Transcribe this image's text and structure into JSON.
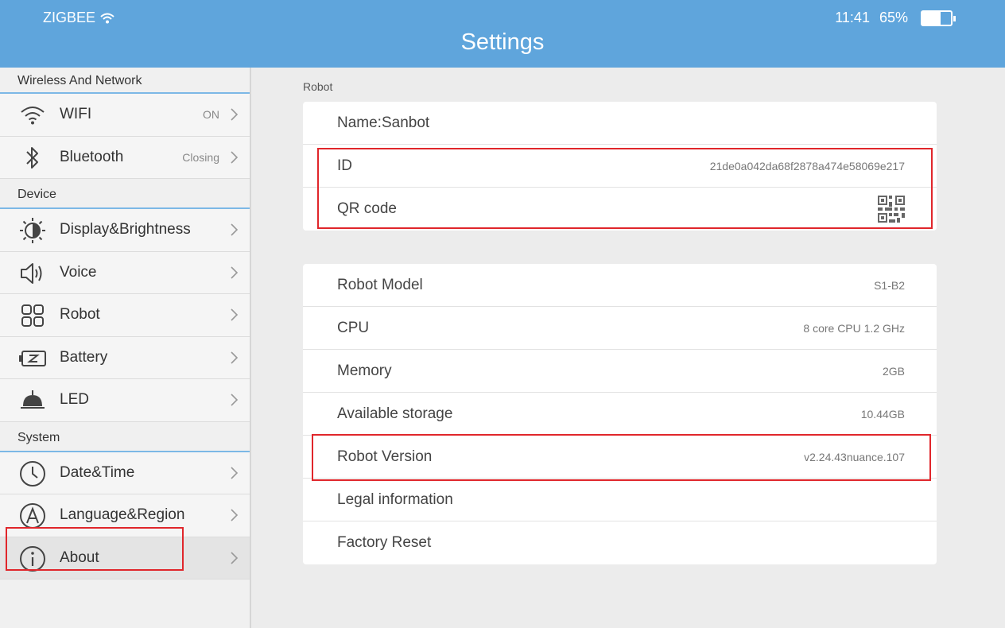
{
  "status_bar": {
    "network": "ZIGBEE",
    "time": "11:41",
    "battery_percent_text": "65%",
    "battery_level": 0.65
  },
  "header": {
    "title": "Settings"
  },
  "sidebar": {
    "sections": [
      {
        "label": "Wireless And Network"
      },
      {
        "label": "Device"
      },
      {
        "label": "System"
      }
    ],
    "items": [
      {
        "label": "WIFI",
        "value": "ON",
        "icon": "wifi-icon"
      },
      {
        "label": "Bluetooth",
        "value": "Closing",
        "icon": "bluetooth-icon"
      },
      {
        "label": "Display&Brightness",
        "icon": "brightness-icon"
      },
      {
        "label": "Voice",
        "icon": "speaker-icon"
      },
      {
        "label": "Robot",
        "icon": "grid-icon"
      },
      {
        "label": "Battery",
        "icon": "battery-icon"
      },
      {
        "label": "LED",
        "icon": "lamp-icon"
      },
      {
        "label": "Date&Time",
        "icon": "clock-icon"
      },
      {
        "label": "Language&Region",
        "icon": "language-icon"
      },
      {
        "label": "About",
        "icon": "info-icon",
        "selected": true
      }
    ]
  },
  "main": {
    "section_label": "Robot",
    "card1": [
      {
        "label": "Name:Sanbot"
      },
      {
        "label": "ID",
        "value": "21de0a042da68f2878a474e58069e217"
      },
      {
        "label": "QR code",
        "icon": "qr-code-icon"
      }
    ],
    "card2": [
      {
        "label": "Robot Model",
        "value": "S1-B2"
      },
      {
        "label": "CPU",
        "value": "8 core CPU 1.2 GHz"
      },
      {
        "label": "Memory",
        "value": "2GB"
      },
      {
        "label": "Available storage",
        "value": "10.44GB"
      },
      {
        "label": "Robot Version",
        "value": "v2.24.43nuance.107"
      },
      {
        "label": "Legal information"
      },
      {
        "label": "Factory Reset"
      }
    ]
  },
  "colors": {
    "header": "#5fa5dc",
    "accent_line": "#7cb8e6",
    "highlight": "#e0262b"
  }
}
